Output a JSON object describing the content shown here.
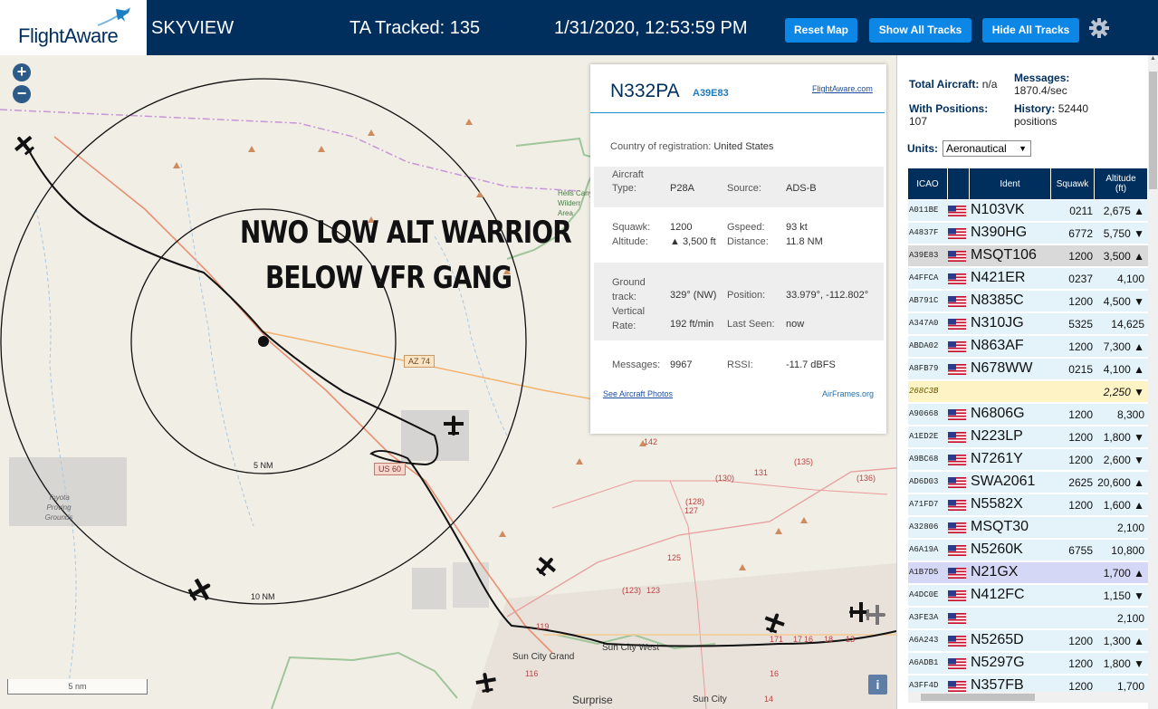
{
  "header": {
    "logo_text": "FlightAware",
    "app_title": "SKYVIEW",
    "tracked": "TA Tracked: 135",
    "datetime": "1/31/2020, 12:53:59 PM",
    "btn_reset": "Reset Map",
    "btn_show": "Show All Tracks",
    "btn_hide": "Hide All Tracks",
    "settings_icon": "gear-icon"
  },
  "map": {
    "zoom_in": "+",
    "zoom_out": "−",
    "overlay_line1": "NWO LOW ALT WARRIOR",
    "overlay_line2": "BELOW VFR GANG",
    "ring_5": "5 NM",
    "ring_10": "10 NM",
    "road_az74": "AZ 74",
    "road_us60": "US 60",
    "place_hells": "Hells Cany Wilderr Area",
    "place_toyota": "Toyota Proving Grounds",
    "place_suncitygrand": "Sun City Grand",
    "place_suncitywest": "Sun City West",
    "place_surprise": "Surprise",
    "place_suncity": "Sun City",
    "scale": "5 nm",
    "info": "i",
    "route_labels": [
      "(130)",
      "131",
      "(135)",
      "(136)",
      "(128)",
      "127",
      "125",
      "123",
      "119",
      "116",
      "142",
      "(123)",
      "171",
      "17",
      "16",
      "18",
      "16",
      "14",
      "13"
    ]
  },
  "popup": {
    "registration": "N332PA",
    "hex": "A39E83",
    "fa_link": "FlightAware.com",
    "country_label": "Country of registration:",
    "country": "United States",
    "type_label": "Aircraft Type:",
    "type": "P28A",
    "source_label": "Source:",
    "source": "ADS-B",
    "squawk_label": "Squawk:",
    "squawk": "1200",
    "gspeed_label": "Gspeed:",
    "gspeed": "93 kt",
    "altitude_label": "Altitude:",
    "altitude": "▲ 3,500 ft",
    "distance_label": "Distance:",
    "distance": "11.8 NM",
    "track_label": "Ground track:",
    "track": "329° (NW)",
    "position_label": "Position:",
    "position": "33.979°, -112.802°",
    "vrate_label": "Vertical Rate:",
    "vrate": "192 ft/min",
    "lastseen_label": "Last Seen:",
    "lastseen": "now",
    "messages_label": "Messages:",
    "messages": "9967",
    "rssi_label": "RSSI:",
    "rssi": "-11.7 dBFS",
    "photos_link": "See Aircraft Photos",
    "airframes_link": "AirFrames.org"
  },
  "sidebar": {
    "total_label": "Total Aircraft:",
    "total_value": "n/a",
    "positions_label": "With Positions:",
    "positions_value": "107",
    "messages_label": "Messages:",
    "messages_value": "1870.4/sec",
    "history_label": "History:",
    "history_value": "52440",
    "history_unit": "positions",
    "units_label": "Units:",
    "units_value": "Aeronautical",
    "columns": [
      "ICAO",
      "",
      "Ident",
      "Squawk",
      "Altitude (ft)"
    ],
    "rows": [
      {
        "icao": "A011BE",
        "flag": true,
        "ident": "N103VK",
        "squawk": "0211",
        "alt": "2,675 ▲",
        "bg": "#e4f3fa"
      },
      {
        "icao": "A4837F",
        "flag": true,
        "ident": "N390HG",
        "squawk": "6772",
        "alt": "5,750 ▼",
        "bg": "#e4f3fa"
      },
      {
        "icao": "A39E83",
        "flag": true,
        "ident": "MSQT106",
        "squawk": "1200",
        "alt": "3,500 ▲",
        "bg": "#d9d9d9"
      },
      {
        "icao": "A4FFCA",
        "flag": true,
        "ident": "N421ER",
        "squawk": "0237",
        "alt": "4,100",
        "bg": "#e4f3fa"
      },
      {
        "icao": "AB791C",
        "flag": true,
        "ident": "N8385C",
        "squawk": "1200",
        "alt": "4,500 ▼",
        "bg": "#e4f3fa"
      },
      {
        "icao": "A347A0",
        "flag": true,
        "ident": "N310JG",
        "squawk": "5325",
        "alt": "14,625",
        "bg": "#e4f3fa"
      },
      {
        "icao": "ABDA02",
        "flag": true,
        "ident": "N863AF",
        "squawk": "1200",
        "alt": "7,300 ▲",
        "bg": "#e4f3fa"
      },
      {
        "icao": "A8FB79",
        "flag": true,
        "ident": "N678WW",
        "squawk": "0215",
        "alt": "4,100 ▲",
        "bg": "#e4f3fa"
      },
      {
        "icao": "268C3B",
        "flag": false,
        "ident": "",
        "squawk": "",
        "alt": "2,250 ▼",
        "bg": "#fdf3c4",
        "italic": true
      },
      {
        "icao": "A90668",
        "flag": true,
        "ident": "N6806G",
        "squawk": "1200",
        "alt": "8,300",
        "bg": "#e4f3fa"
      },
      {
        "icao": "A1ED2E",
        "flag": true,
        "ident": "N223LP",
        "squawk": "1200",
        "alt": "1,800 ▼",
        "bg": "#e4f3fa"
      },
      {
        "icao": "A9BC68",
        "flag": true,
        "ident": "N7261Y",
        "squawk": "1200",
        "alt": "2,600 ▼",
        "bg": "#e4f3fa"
      },
      {
        "icao": "AD6D03",
        "flag": true,
        "ident": "SWA2061",
        "squawk": "2625",
        "alt": "20,600 ▲",
        "bg": "#e4f3fa"
      },
      {
        "icao": "A71FD7",
        "flag": true,
        "ident": "N5582X",
        "squawk": "1200",
        "alt": "1,600 ▲",
        "bg": "#e4f3fa"
      },
      {
        "icao": "A32806",
        "flag": true,
        "ident": "MSQT30",
        "squawk": "",
        "alt": "2,100",
        "bg": "#e4f3fa"
      },
      {
        "icao": "A6A19A",
        "flag": true,
        "ident": "N5260K",
        "squawk": "6755",
        "alt": "10,800",
        "bg": "#e4f3fa"
      },
      {
        "icao": "A1B7D5",
        "flag": true,
        "ident": "N21GX",
        "squawk": "",
        "alt": "1,700 ▲",
        "bg": "#d4d7f5"
      },
      {
        "icao": "A4DC0E",
        "flag": true,
        "ident": "N412FC",
        "squawk": "",
        "alt": "1,150 ▼",
        "bg": "#e4f3fa"
      },
      {
        "icao": "A3FE3A",
        "flag": true,
        "ident": "",
        "squawk": "",
        "alt": "2,100",
        "bg": "#e4f3fa"
      },
      {
        "icao": "A6A243",
        "flag": true,
        "ident": "N5265D",
        "squawk": "1200",
        "alt": "1,300 ▲",
        "bg": "#e4f3fa"
      },
      {
        "icao": "A6ADB1",
        "flag": true,
        "ident": "N5297G",
        "squawk": "1200",
        "alt": "1,800 ▼",
        "bg": "#e4f3fa"
      },
      {
        "icao": "A3FF4D",
        "flag": true,
        "ident": "N357FB",
        "squawk": "1200",
        "alt": "1,700",
        "bg": "#e4f3fa"
      }
    ]
  },
  "colors": {
    "header_bg": "#002f5d",
    "button_bg": "#0d87e6",
    "map_bg": "#f1eee5",
    "row_bg": "#e4f3fa",
    "selected_row": "#d9d9d9",
    "accent_link": "#1d7bbf"
  }
}
